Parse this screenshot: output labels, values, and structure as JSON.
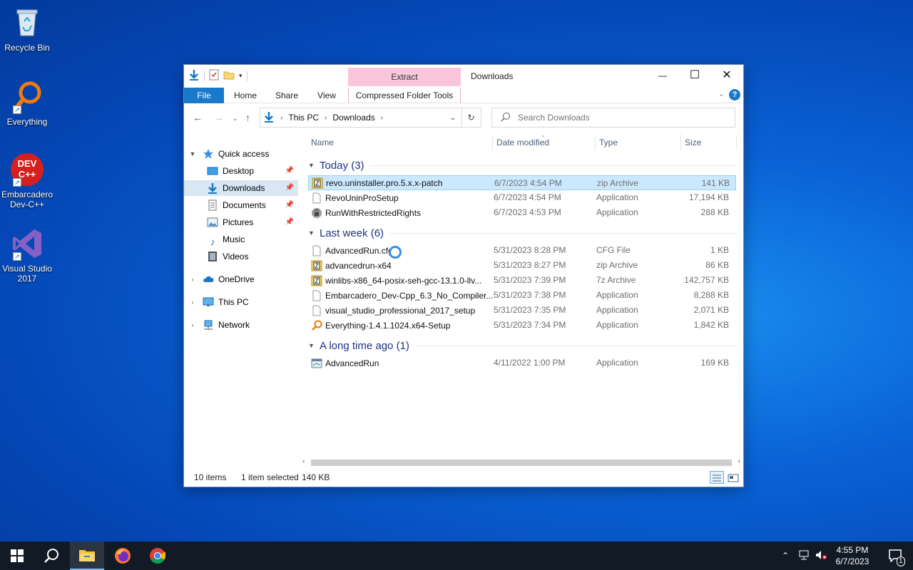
{
  "desktop": {
    "icons": [
      {
        "label": "Recycle Bin",
        "icon": "recycle-bin-icon"
      },
      {
        "label": "Everything",
        "icon": "everything-magnifier-icon"
      },
      {
        "label": "Embarcadero Dev-C++",
        "icon": "devcpp-icon"
      },
      {
        "label": "Visual Studio 2017",
        "icon": "visual-studio-icon"
      }
    ],
    "devcpp_logo_text": "DEV C++"
  },
  "window": {
    "title": "Downloads",
    "contextual_tab": "Extract",
    "ribbon_tabs": [
      "File",
      "Home",
      "Share",
      "View",
      "Compressed Folder Tools"
    ],
    "controls": {
      "minimize": "—",
      "maximize": "☐",
      "close": "✕"
    },
    "help": "?"
  },
  "address": {
    "segments": [
      "This PC",
      "Downloads"
    ],
    "search_placeholder": "Search Downloads"
  },
  "navpane": {
    "items": [
      {
        "label": "Quick access",
        "icon": "star-icon"
      },
      {
        "label": "Desktop",
        "icon": "desktop-folder-icon",
        "pinned": true
      },
      {
        "label": "Downloads",
        "icon": "downloads-arrow-icon",
        "pinned": true
      },
      {
        "label": "Documents",
        "icon": "documents-icon",
        "pinned": true
      },
      {
        "label": "Pictures",
        "icon": "pictures-icon",
        "pinned": true
      },
      {
        "label": "Music",
        "icon": "music-note-icon"
      },
      {
        "label": "Videos",
        "icon": "video-icon"
      },
      {
        "label": "OneDrive",
        "icon": "cloud-icon"
      },
      {
        "label": "This PC",
        "icon": "monitor-icon"
      },
      {
        "label": "Network",
        "icon": "network-icon"
      }
    ]
  },
  "columns": {
    "name": "Name",
    "date": "Date modified",
    "type": "Type",
    "size": "Size"
  },
  "groups": [
    {
      "label": "Today (3)",
      "files": [
        {
          "name": "revo.uninstaller.pro.5.x.x-patch",
          "date": "6/7/2023 4:54 PM",
          "type": "zip Archive",
          "size": "141 KB",
          "icon": "zip-icon",
          "selected": true
        },
        {
          "name": "RevoUninProSetup",
          "date": "6/7/2023 4:54 PM",
          "type": "Application",
          "size": "17,194 KB",
          "icon": "blank-file-icon"
        },
        {
          "name": "RunWithRestrictedRights",
          "date": "6/7/2023 4:53 PM",
          "type": "Application",
          "size": "288 KB",
          "icon": "lock-app-icon"
        }
      ]
    },
    {
      "label": "Last week (6)",
      "files": [
        {
          "name": "AdvancedRun.cfg",
          "date": "5/31/2023 8:28 PM",
          "type": "CFG File",
          "size": "1 KB",
          "icon": "blank-file-icon"
        },
        {
          "name": "advancedrun-x64",
          "date": "5/31/2023 8:27 PM",
          "type": "zip Archive",
          "size": "86 KB",
          "icon": "zip-icon"
        },
        {
          "name": "winlibs-x86_64-posix-seh-gcc-13.1.0-llv...",
          "date": "5/31/2023 7:39 PM",
          "type": "7z Archive",
          "size": "142,757 KB",
          "icon": "zip-icon"
        },
        {
          "name": "Embarcadero_Dev-Cpp_6.3_No_Compiler...",
          "date": "5/31/2023 7:38 PM",
          "type": "Application",
          "size": "8,288 KB",
          "icon": "blank-file-icon"
        },
        {
          "name": "visual_studio_professional_2017_setup",
          "date": "5/31/2023 7:35 PM",
          "type": "Application",
          "size": "2,071 KB",
          "icon": "blank-file-icon"
        },
        {
          "name": "Everything-1.4.1.1024.x64-Setup",
          "date": "5/31/2023 7:34 PM",
          "type": "Application",
          "size": "1,842 KB",
          "icon": "everything-magnifier-icon"
        }
      ]
    },
    {
      "label": "A long time ago (1)",
      "files": [
        {
          "name": "AdvancedRun",
          "date": "4/11/2022 1:00 PM",
          "type": "Application",
          "size": "169 KB",
          "icon": "app-window-icon"
        }
      ]
    }
  ],
  "status": {
    "count": "10 items",
    "selection": "1 item selected",
    "size": "140 KB"
  },
  "taskbar": {
    "clock_time": "4:55 PM",
    "clock_date": "6/7/2023",
    "notification_count": "1",
    "apps": [
      "start-windows-icon",
      "search-icon",
      "file-explorer-icon",
      "firefox-icon",
      "chrome-icon"
    ]
  },
  "colors": {
    "accent": "#1979ca",
    "selection": "#cce8ff",
    "group_header": "#1e3287",
    "extract_tab": "#f9c6dc"
  }
}
